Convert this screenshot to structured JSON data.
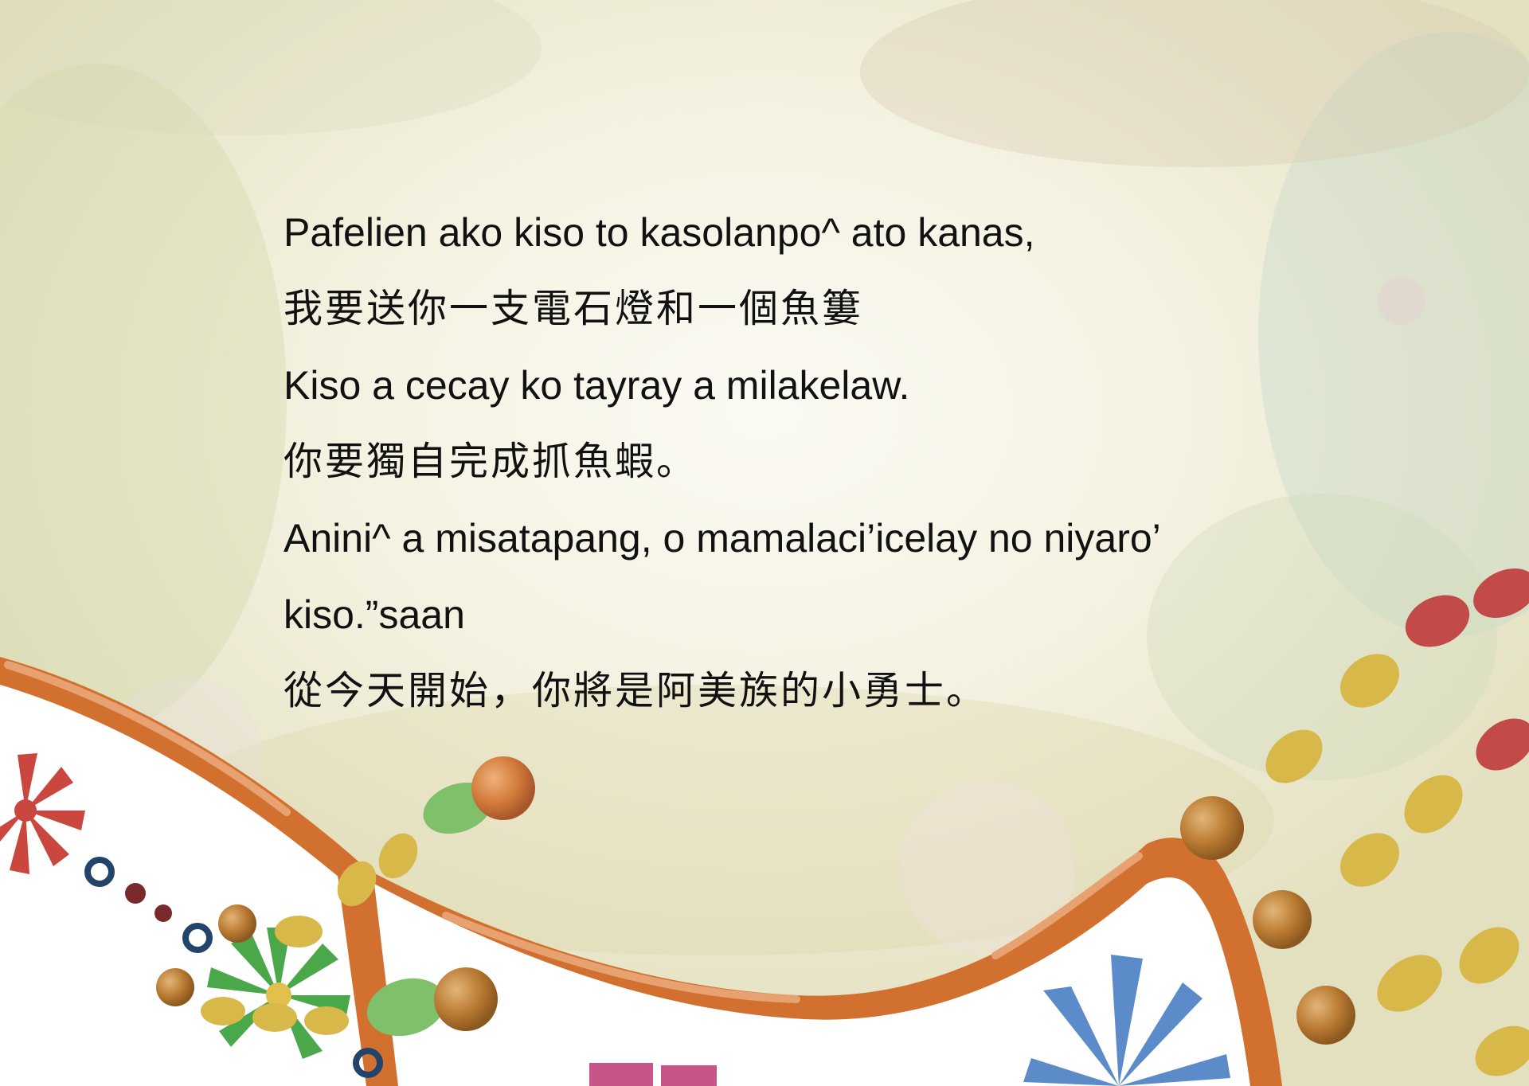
{
  "page": {
    "lines": [
      {
        "lang": "en",
        "text": "Pafelien ako kiso to kasolanpo^ ato kanas,"
      },
      {
        "lang": "zh",
        "text": "我要送你一支電石燈和一個魚簍"
      },
      {
        "lang": "en",
        "text": "Kiso a cecay ko tayray a milakelaw."
      },
      {
        "lang": "zh",
        "text": "你要獨自完成抓魚蝦。"
      },
      {
        "lang": "en",
        "text": "Anini^ a misatapang, o mamalaci’icelay no niyaro’"
      },
      {
        "lang": "en",
        "text": "kiso.”saan"
      },
      {
        "lang": "zh",
        "text": "從今天開始，你將是阿美族的小勇士。"
      }
    ]
  },
  "colors": {
    "band_orange": "#d2712f",
    "band_light": "#e7a070",
    "flower_red": "#c9473f",
    "flower_green": "#4aa84a",
    "flower_blue": "#5b8bc8",
    "bead_gold": "#b97a32",
    "petal_yellow": "#d9b84a",
    "berry_red": "#c24a48",
    "leaf_green": "#7fc06a",
    "ring_blue": "#22436a",
    "pink": "#c8558a"
  },
  "icons": [
    "red-flower-icon",
    "green-flower-icon",
    "blue-flower-icon",
    "bead-icon",
    "leaf-icon"
  ]
}
